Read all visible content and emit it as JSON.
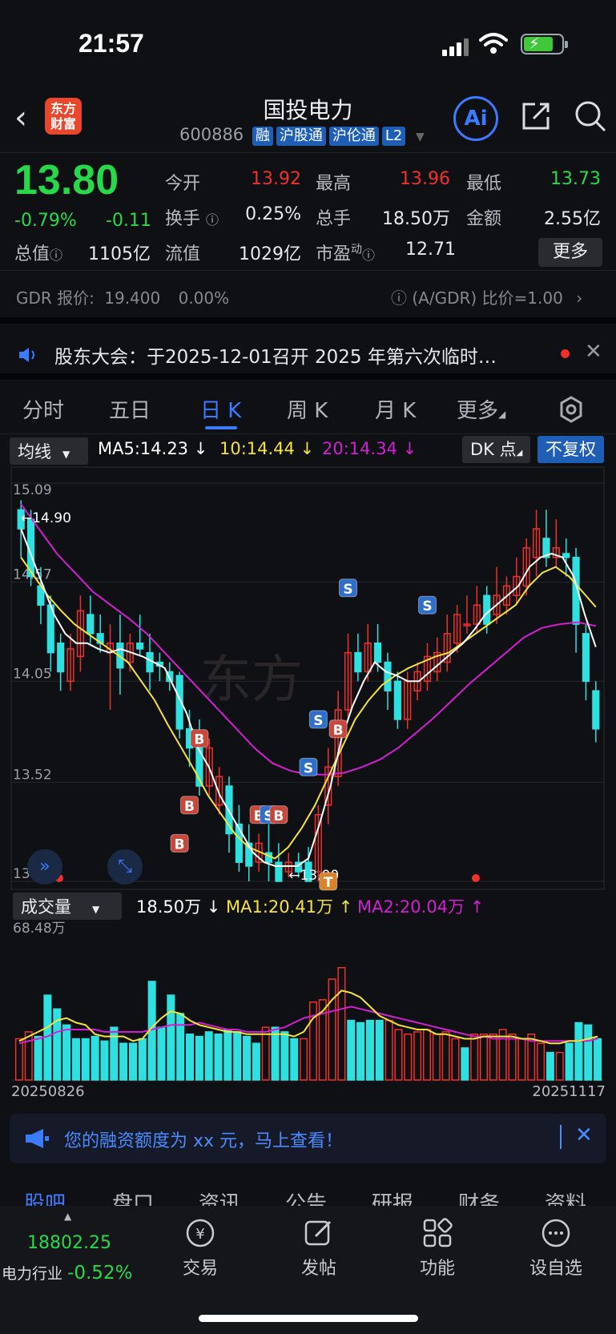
{
  "status": {
    "time": "21:57"
  },
  "header": {
    "logo_text": "东方财富",
    "title": "国投电力",
    "code": "600886",
    "tags": [
      "融",
      "沪股通",
      "沪伦通",
      "L2"
    ],
    "ai_label": "Ai"
  },
  "quote": {
    "price": "13.80",
    "change_pct": "-0.79%",
    "change": "-0.11",
    "open_label": "今开",
    "open": "13.92",
    "high_label": "最高",
    "high": "13.96",
    "low_label": "最低",
    "low": "13.73",
    "turnover_label": "换手",
    "turnover": "0.25%",
    "volume_label": "总手",
    "volume": "18.50万",
    "amount_label": "金额",
    "amount": "2.55亿",
    "mktcap_label": "总值",
    "mktcap": "1105亿",
    "float_label": "流值",
    "float": "1029亿",
    "pe_label": "市盈",
    "pe_sup": "动",
    "pe": "12.71",
    "more_label": "更多"
  },
  "gdr": {
    "label": "GDR 报价:",
    "price": "19.400",
    "pct": "0.00%",
    "ratio": "(A/GDR) 比价=1.00"
  },
  "notice": {
    "text": "股东大会：于2025-12-01召开 2025 年第六次临时…"
  },
  "tabs": [
    "分时",
    "五日",
    "日 K",
    "周 K",
    "月 K",
    "更多"
  ],
  "ma_bar": {
    "selector": "均线",
    "ma5": "MA5:14.23",
    "ma10": "10:14.44",
    "ma20": "20:14.34",
    "dk": "DK 点",
    "fuquan": "不复权"
  },
  "vol_bar": {
    "selector": "成交量",
    "vol": "18.50万",
    "ma1": "MA1:20.41万",
    "ma2": "MA2:20.04万"
  },
  "colors": {
    "up": "#f0302a",
    "down": "#2ee0e0",
    "ma5": "#ffffff",
    "ma10": "#f5e33a",
    "ma20": "#d21fd2",
    "accent": "#3a7bff"
  },
  "chart_data": [
    {
      "type": "candlestick",
      "y_ticks": [
        "15.09",
        "14.57",
        "14.05",
        "13.52",
        "13.00"
      ],
      "ylim": [
        13.0,
        15.09
      ],
      "max_label": "←14.90",
      "min_label": "←13.00",
      "candles": [
        [
          14.95,
          14.85,
          15.0,
          14.7
        ],
        [
          14.9,
          14.6,
          14.95,
          14.55
        ],
        [
          14.55,
          14.45,
          14.65,
          14.35
        ],
        [
          14.45,
          14.2,
          14.5,
          14.1
        ],
        [
          14.25,
          14.1,
          14.3,
          14.0
        ],
        [
          14.05,
          14.22,
          14.3,
          14.0
        ],
        [
          14.18,
          14.42,
          14.5,
          14.1
        ],
        [
          14.4,
          14.3,
          14.5,
          14.25
        ],
        [
          14.3,
          14.25,
          14.4,
          14.2
        ],
        [
          14.2,
          14.25,
          14.35,
          13.9
        ],
        [
          14.25,
          14.12,
          14.4,
          13.98
        ],
        [
          14.15,
          14.25,
          14.3,
          14.1
        ],
        [
          14.25,
          14.22,
          14.4,
          14.18
        ],
        [
          14.2,
          14.1,
          14.3,
          14.0
        ],
        [
          14.15,
          14.13,
          14.2,
          14.05
        ],
        [
          14.1,
          14.05,
          14.15,
          14.0
        ],
        [
          14.08,
          13.8,
          14.1,
          13.75
        ],
        [
          13.8,
          13.7,
          13.9,
          13.6
        ],
        [
          13.7,
          13.5,
          13.85,
          13.45
        ],
        [
          13.5,
          13.7,
          13.75,
          13.45
        ],
        [
          13.4,
          13.55,
          13.6,
          13.35
        ],
        [
          13.5,
          13.25,
          13.55,
          13.15
        ],
        [
          13.3,
          13.1,
          13.4,
          13.05
        ],
        [
          13.2,
          13.08,
          13.3,
          13.0
        ],
        [
          13.1,
          13.2,
          13.25,
          13.05
        ],
        [
          13.15,
          13.1,
          13.3,
          13.0
        ],
        [
          13.1,
          13.0,
          13.2,
          13.0
        ],
        [
          13.05,
          13.1,
          13.15,
          13.02
        ],
        [
          13.1,
          13.05,
          13.15,
          13.02
        ],
        [
          13.1,
          13.0,
          13.18,
          13.0
        ],
        [
          13.05,
          13.35,
          13.4,
          13.0
        ],
        [
          13.4,
          13.6,
          13.7,
          13.3
        ],
        [
          13.55,
          13.9,
          14.0,
          13.5
        ],
        [
          13.9,
          14.2,
          14.3,
          13.85
        ],
        [
          14.2,
          14.1,
          14.3,
          14.05
        ],
        [
          14.1,
          14.25,
          14.35,
          14.05
        ],
        [
          14.25,
          14.15,
          14.35,
          14.1
        ],
        [
          14.15,
          14.0,
          14.2,
          13.9
        ],
        [
          14.05,
          13.85,
          14.1,
          13.8
        ],
        [
          13.85,
          14.05,
          14.1,
          13.8
        ],
        [
          14.0,
          14.1,
          14.15,
          13.95
        ],
        [
          14.05,
          14.18,
          14.25,
          14.0
        ],
        [
          14.1,
          14.2,
          14.28,
          14.05
        ],
        [
          14.15,
          14.3,
          14.4,
          14.1
        ],
        [
          14.25,
          14.4,
          14.45,
          14.2
        ],
        [
          14.35,
          14.35,
          14.5,
          14.3
        ],
        [
          14.35,
          14.45,
          14.55,
          14.3
        ],
        [
          14.5,
          14.35,
          14.55,
          14.3
        ],
        [
          14.4,
          14.5,
          14.65,
          14.35
        ],
        [
          14.45,
          14.55,
          14.6,
          14.4
        ],
        [
          14.5,
          14.6,
          14.7,
          14.45
        ],
        [
          14.55,
          14.75,
          14.8,
          14.5
        ],
        [
          14.7,
          14.85,
          14.95,
          14.6
        ],
        [
          14.8,
          14.7,
          14.95,
          14.65
        ],
        [
          14.7,
          14.75,
          14.9,
          14.65
        ],
        [
          14.72,
          14.7,
          14.8,
          14.6
        ],
        [
          14.7,
          14.35,
          14.75,
          14.2
        ],
        [
          14.3,
          14.05,
          14.35,
          13.95
        ],
        [
          14.0,
          13.8,
          14.05,
          13.73
        ]
      ],
      "ma5": [
        14.85,
        14.7,
        14.55,
        14.4,
        14.3,
        14.25,
        14.25,
        14.22,
        14.2,
        14.22,
        14.2,
        14.18,
        14.15,
        14.12,
        14.0,
        13.88,
        13.7,
        13.6,
        13.45,
        13.35,
        13.25,
        13.15,
        13.1,
        13.08,
        13.08,
        13.08,
        13.12,
        13.3,
        13.5,
        13.75,
        13.92,
        14.05,
        14.15,
        14.1,
        14.08,
        14.05,
        14.05,
        14.1,
        14.15,
        14.2,
        14.25,
        14.32,
        14.4,
        14.45,
        14.5,
        14.55,
        14.65,
        14.7,
        14.72,
        14.7,
        14.6,
        14.4,
        14.23
      ],
      "ma10": [
        14.7,
        14.6,
        14.5,
        14.42,
        14.35,
        14.3,
        14.25,
        14.2,
        14.15,
        14.05,
        13.95,
        13.82,
        13.7,
        13.58,
        13.45,
        13.35,
        13.25,
        13.18,
        13.15,
        13.12,
        13.18,
        13.28,
        13.4,
        13.55,
        13.7,
        13.85,
        13.95,
        14.03,
        14.08,
        14.12,
        14.15,
        14.18,
        14.2,
        14.25,
        14.3,
        14.35,
        14.4,
        14.45,
        14.55,
        14.62,
        14.65,
        14.6,
        14.52,
        14.44
      ],
      "ma20": [
        14.98,
        14.85,
        14.72,
        14.62,
        14.52,
        14.45,
        14.38,
        14.3,
        14.2,
        14.1,
        14.0,
        13.9,
        13.8,
        13.7,
        13.62,
        13.58,
        13.56,
        13.56,
        13.57,
        13.6,
        13.64,
        13.7,
        13.78,
        13.86,
        13.95,
        14.04,
        14.12,
        14.2,
        14.28,
        14.33,
        14.35,
        14.36,
        14.34
      ],
      "markers": [
        {
          "label": "B",
          "type": "buy"
        },
        {
          "label": "B",
          "type": "buy"
        },
        {
          "label": "B",
          "type": "buy"
        },
        {
          "label": "B",
          "type": "buy"
        },
        {
          "label": "S",
          "type": "sell"
        },
        {
          "label": "B",
          "type": "buy"
        },
        {
          "label": "S",
          "type": "sell"
        },
        {
          "label": "S",
          "type": "sell"
        },
        {
          "label": "T",
          "type": "t"
        },
        {
          "label": "B",
          "type": "buy"
        },
        {
          "label": "S",
          "type": "sell"
        },
        {
          "label": "S",
          "type": "sell"
        }
      ]
    },
    {
      "type": "bar",
      "title": "成交量",
      "y_max_label": "68.48万",
      "x_start": "20250826",
      "x_end": "20251117",
      "ylim": [
        0,
        68.48
      ],
      "values": [
        18,
        21,
        19,
        37,
        31,
        24,
        18,
        18,
        19,
        17,
        23,
        16,
        16,
        18,
        43,
        23,
        37,
        29,
        20,
        19,
        21,
        20,
        22,
        21,
        19,
        16,
        23,
        23,
        21,
        18,
        18,
        34,
        35,
        44,
        49,
        26,
        25,
        26,
        26,
        26,
        22,
        20,
        21,
        22,
        20,
        21,
        18,
        14,
        20,
        20,
        20,
        22,
        20,
        18,
        20,
        16,
        12,
        12,
        16,
        25,
        24,
        18
      ],
      "up": [
        1,
        1,
        0,
        0,
        0,
        0,
        0,
        0,
        0,
        0,
        0,
        0,
        0,
        0,
        0,
        0,
        0,
        0,
        0,
        0,
        0,
        0,
        0,
        0,
        0,
        0,
        1,
        0,
        0,
        0,
        1,
        1,
        1,
        1,
        1,
        0,
        0,
        0,
        0,
        1,
        1,
        1,
        1,
        1,
        1,
        1,
        1,
        0,
        1,
        1,
        1,
        1,
        1,
        1,
        1,
        1,
        0,
        1,
        0,
        0,
        0,
        0
      ],
      "ma1": [
        17,
        19,
        21,
        23,
        26,
        27,
        25,
        24,
        20,
        19,
        19,
        19,
        17,
        18,
        23,
        27,
        30,
        29,
        26,
        24,
        23,
        22,
        21,
        21,
        20,
        20,
        20,
        20,
        20,
        19,
        21,
        27,
        30,
        35,
        39,
        38,
        36,
        32,
        28,
        26,
        24,
        23,
        22,
        22,
        20,
        20,
        19,
        18,
        18,
        19,
        19,
        19,
        19,
        18,
        18,
        17,
        16,
        16,
        17,
        17,
        18,
        19
      ],
      "ma2": [
        16,
        17,
        18,
        19,
        21,
        22,
        22,
        22,
        22,
        21,
        21,
        21,
        21,
        21,
        22,
        23,
        24,
        24,
        24,
        25,
        24,
        23,
        22,
        22,
        21,
        21,
        21,
        22,
        23,
        25,
        27,
        28,
        29,
        30,
        31,
        32,
        31,
        30,
        29,
        28,
        27,
        26,
        25,
        24,
        23,
        22,
        21,
        20,
        19,
        19,
        18,
        18,
        18,
        18,
        17,
        17,
        17,
        17,
        17,
        17,
        17,
        18
      ]
    }
  ],
  "banner": {
    "text": "您的融资额度为 xx 元，马上查看！"
  },
  "bottom_tabs": [
    "股吧",
    "盘口",
    "资讯",
    "公告",
    "研报",
    "财务",
    "资料"
  ],
  "bottom_nav": {
    "index_value": "18802.25",
    "index_name": "电力行业",
    "index_pct": "-0.52%",
    "items": [
      "交易",
      "发帖",
      "功能",
      "设自选"
    ]
  }
}
